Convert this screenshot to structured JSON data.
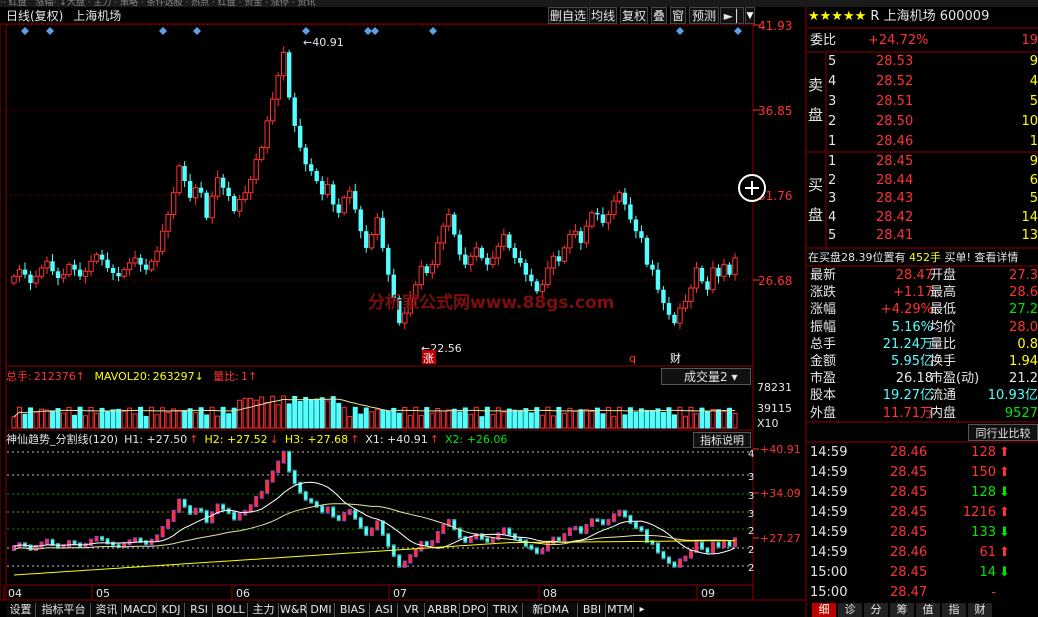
{
  "top_strip": "  ··  红盘　涨幅· ↓大盘 · 主力 · 策略 · 条件选股 · 热点  · 红盘 · 资金 · 涨停 · 资讯",
  "header": {
    "period": "日线(复权)",
    "stock_name": "上海机场"
  },
  "toolbar": [
    "删自选",
    "均线",
    "复权",
    "叠",
    "窗",
    "预测"
  ],
  "price_axis": [
    "41.93",
    "36.85",
    "31.76",
    "26.68"
  ],
  "price_marks": {
    "high": "40.91",
    "low": "22.56"
  },
  "bottom_markers": [
    "涨",
    "q",
    "财"
  ],
  "watermark": "分析家公式网www.88gs.com",
  "volume_panel": {
    "header_label": "总手:",
    "total_val": "212376",
    "mavol_label": "MAVOL20:",
    "mavol_val": "263297",
    "ratio_label": "量比:",
    "ratio_val": "1",
    "dropdown": "成交量2",
    "axis": [
      "78231",
      "39115",
      "X10"
    ]
  },
  "indicator_panel": {
    "name": "神仙趋势_分割线(120)",
    "h1": "H1: +27.50",
    "h2": "H2: +27.52",
    "h3": "H3: +27.68",
    "x1": "X1: +40.91",
    "x2": "X2: +26.06",
    "help": "指标说明",
    "axis": [
      "+40.91",
      "+34.09",
      "+27.27"
    ],
    "levels": [
      "4",
      "3",
      "3",
      "3",
      "2",
      "2",
      "2"
    ]
  },
  "x_axis": [
    "04",
    "05",
    "06",
    "07",
    "08",
    "09"
  ],
  "bottom_tabs": [
    "设置",
    "指标平台",
    "资讯",
    "MACD",
    "KDJ",
    "RSI",
    "BOLL",
    "主力",
    "W&R",
    "DMI",
    "BIAS",
    "ASI",
    "VR",
    "ARBR",
    "DPO",
    "TRIX",
    "新DMA",
    "BBI",
    "MTM"
  ],
  "quote": {
    "title": "R 上海机场  600009",
    "weibi_label": "委比",
    "weibi_val": "+24.72%",
    "weibi_right": "19",
    "sell_label": "卖盘",
    "buy_label": "买盘",
    "sells": [
      {
        "lvl": "5",
        "price": "28.53",
        "vol": "9"
      },
      {
        "lvl": "4",
        "price": "28.52",
        "vol": "4"
      },
      {
        "lvl": "3",
        "price": "28.51",
        "vol": "5"
      },
      {
        "lvl": "2",
        "price": "28.50",
        "vol": "10"
      },
      {
        "lvl": "1",
        "price": "28.46",
        "vol": "1"
      }
    ],
    "buys": [
      {
        "lvl": "1",
        "price": "28.45",
        "vol": "9"
      },
      {
        "lvl": "2",
        "price": "28.44",
        "vol": "6"
      },
      {
        "lvl": "3",
        "price": "28.43",
        "vol": "5"
      },
      {
        "lvl": "4",
        "price": "28.42",
        "vol": "14"
      },
      {
        "lvl": "5",
        "price": "28.41",
        "vol": "13"
      }
    ],
    "buy_pos_text": "在买盘28.39位置有",
    "buy_pos_vol": "452手",
    "buy_pos_link": "买单! 查看详情",
    "stats": [
      {
        "l1": "最新",
        "v1": "28.47",
        "c1": "red",
        "l2": "开盘",
        "v2": "27.3",
        "c2": "red"
      },
      {
        "l1": "涨跌",
        "v1": "+1.17",
        "c1": "red",
        "l2": "最高",
        "v2": "28.6",
        "c2": "red"
      },
      {
        "l1": "涨幅",
        "v1": "+4.29%",
        "c1": "red",
        "l2": "最低",
        "v2": "27.2",
        "c2": "grn"
      },
      {
        "l1": "振幅",
        "v1": "5.16%",
        "c1": "cyn",
        "l2": "均价",
        "v2": "28.0",
        "c2": "red"
      },
      {
        "l1": "总手",
        "v1": "21.24万",
        "c1": "cyn",
        "l2": "量比",
        "v2": "0.8",
        "c2": "yel"
      },
      {
        "l1": "金额",
        "v1": "5.95亿",
        "c1": "cyn",
        "l2": "换手",
        "v2": "1.94",
        "c2": "yel"
      },
      {
        "l1": "市盈",
        "v1": "26.18",
        "c1": "wht",
        "l2": "市盈(动)",
        "v2": "21.2",
        "c2": "wht"
      },
      {
        "l1": "股本",
        "v1": "19.27亿",
        "c1": "cyn",
        "l2": "流通",
        "v2": "10.93亿",
        "c2": "cyn"
      },
      {
        "l1": "外盘",
        "v1": "11.71万",
        "c1": "red",
        "l2": "内盘",
        "v2": "9527",
        "c2": "grn"
      }
    ],
    "industry_btn": "同行业比较",
    "ticks": [
      {
        "t": "14:59",
        "p": "28.46",
        "v": "128",
        "d": "up"
      },
      {
        "t": "14:59",
        "p": "28.45",
        "v": "150",
        "d": "up"
      },
      {
        "t": "14:59",
        "p": "28.45",
        "v": "128",
        "d": "down"
      },
      {
        "t": "14:59",
        "p": "28.45",
        "v": "1216",
        "d": "up"
      },
      {
        "t": "14:59",
        "p": "28.45",
        "v": "133",
        "d": "down"
      },
      {
        "t": "14:59",
        "p": "28.46",
        "v": "61",
        "d": "up"
      },
      {
        "t": "15:00",
        "p": "28.45",
        "v": "14",
        "d": "down"
      },
      {
        "t": "15:00",
        "p": "28.47",
        "v": "-",
        "d": ""
      }
    ],
    "bottom_tabs": [
      "细",
      "诊",
      "分",
      "筹",
      "值",
      "指",
      "财"
    ]
  },
  "colors": {
    "up": "#ff3232",
    "down": "#54ffff",
    "grid": "#8b0000",
    "bg": "#000000"
  }
}
